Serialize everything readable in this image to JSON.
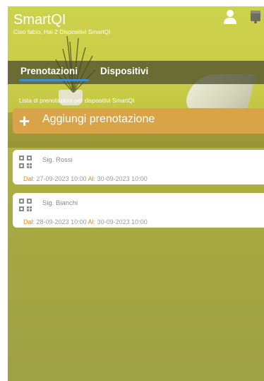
{
  "app": {
    "title": "SmartQI",
    "greeting": "Ciao fabio, Hai 2 Dispositivi SmartQI"
  },
  "icons": {
    "user": "user-icon",
    "device": "device-icon",
    "add": "plus-icon",
    "qr": "qr-code-icon"
  },
  "tabs": [
    {
      "label": "Prenotazioni",
      "active": true
    },
    {
      "label": "Dispositivi",
      "active": false
    }
  ],
  "list_caption": "Lista di prenotazioni per dispositivi SmartQI",
  "add_button": {
    "plus": "+",
    "label": "Aggiungi prenotazione"
  },
  "bookings": [
    {
      "name": "Sig. Rossi",
      "from_label": "Dal:",
      "from": "27-09-2023 10:00",
      "to_label": "Al:",
      "to": "30-09-2023 10:00"
    },
    {
      "name": "Sig. Bianchi",
      "from_label": "Dal:",
      "from": "28-09-2023 10:00",
      "to_label": "Al:",
      "to": "30-09-2023 10:00"
    }
  ],
  "colors": {
    "accent": "#3e8fd6",
    "button": "#d9a448",
    "date_label": "#e08a1e"
  }
}
